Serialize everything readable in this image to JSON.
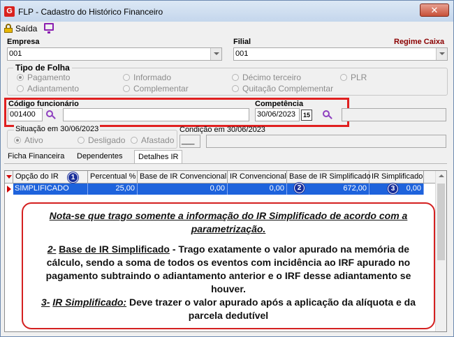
{
  "window": {
    "title": "FLP - Cadastro do Histórico Financeiro",
    "app_icon_letter": "G",
    "close_label": "✕"
  },
  "toolbar": {
    "saida_label": "Saída"
  },
  "empresa": {
    "label": "Empresa",
    "value": "001"
  },
  "filial": {
    "label": "Filial",
    "value": "001",
    "regime_label": "Regime Caixa"
  },
  "tipo_folha": {
    "title": "Tipo de Folha",
    "options": [
      "Pagamento",
      "Informado",
      "Décimo terceiro",
      "PLR",
      "Adiantamento",
      "Complementar",
      "Quitação Complementar"
    ],
    "selected": "Pagamento"
  },
  "codigo": {
    "label": "Código funcionário",
    "value": "001400",
    "name_value": ""
  },
  "competencia": {
    "label": "Competência",
    "value": "30/06/2023",
    "calendar_label": "15"
  },
  "situacao": {
    "title": "Situação em  30/06/2023",
    "options": [
      "Ativo",
      "Desligado",
      "Afastado"
    ],
    "selected": "Ativo"
  },
  "condicao": {
    "title": "Condição em 30/06/2023",
    "code_value": "___",
    "desc_value": ""
  },
  "tabs": [
    {
      "label": "Ficha Financeira"
    },
    {
      "label": "Dependentes"
    },
    {
      "label": "Detalhes IR"
    }
  ],
  "active_tab": "Detalhes IR",
  "grid": {
    "columns": [
      "Opção do IR",
      "Percentual %",
      "Base de IR Convencional",
      "IR Convencional",
      "Base de IR Simplificado",
      "IR Simplificado"
    ],
    "rows": [
      {
        "opcao": "SIMPLIFICADO",
        "percentual": "25,00",
        "base_conv": "0,00",
        "ir_conv": "0,00",
        "base_simpl": "672,00",
        "ir_simpl": "0,00"
      }
    ]
  },
  "badges": [
    "1",
    "2",
    "3"
  ],
  "note": {
    "p1": "Nota-se que trago somente a informação do IR Simplificado de acordo com a parametrização.",
    "p2_num": "2-",
    "p2_title": "Base de IR Simplificado",
    "p2_text": " - Trago exatamente o valor apurado na memória de cálculo, sendo a soma de todos os eventos com incidência ao IRF apurado no pagamento subtraindo o adiantamento anterior e o IRF desse adiantamento se houver.",
    "p3_num": "3-",
    "p3_title": "IR Simplificado:",
    "p3_text": " Deve trazer o valor apurado após a aplicação da alíquota e da parcela dedutível"
  },
  "colors": {
    "highlight": "#e02020",
    "selection": "#1e63dc",
    "badge": "#1a2f9a"
  }
}
